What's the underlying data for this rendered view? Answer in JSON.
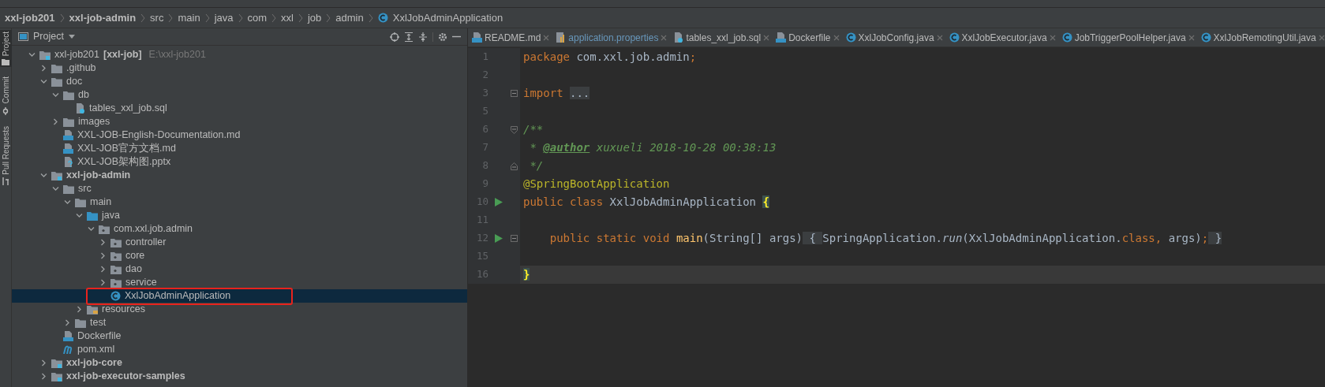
{
  "breadcrumbs": [
    {
      "label": "xxl-job201",
      "bold": true,
      "kind": "text"
    },
    {
      "label": "xxl-job-admin",
      "bold": true,
      "kind": "text"
    },
    {
      "label": "src",
      "bold": false,
      "kind": "text"
    },
    {
      "label": "main",
      "bold": false,
      "kind": "text"
    },
    {
      "label": "java",
      "bold": false,
      "kind": "text"
    },
    {
      "label": "com",
      "bold": false,
      "kind": "text"
    },
    {
      "label": "xxl",
      "bold": false,
      "kind": "text"
    },
    {
      "label": "job",
      "bold": false,
      "kind": "text"
    },
    {
      "label": "admin",
      "bold": false,
      "kind": "text"
    },
    {
      "label": "XxlJobAdminApplication",
      "bold": false,
      "kind": "class"
    }
  ],
  "tool_window_tabs": [
    {
      "label": "Project",
      "selected": true,
      "kind": "folder"
    },
    {
      "label": "Commit",
      "selected": false,
      "kind": "commit"
    },
    {
      "label": "Pull Requests",
      "selected": false,
      "kind": "pull"
    }
  ],
  "project_panel": {
    "title": "Project",
    "tree": [
      {
        "label": "xxl-job201",
        "suffix": "[xxl-job]",
        "hint": "E:\\xxl-job201",
        "kind": "module",
        "bold": false,
        "selected": false,
        "expanded": true,
        "children": [
          {
            "label": ".github",
            "kind": "folder",
            "bold": false,
            "selected": false,
            "expanded": false
          },
          {
            "label": "doc",
            "kind": "folder",
            "bold": false,
            "selected": false,
            "expanded": true,
            "children": [
              {
                "label": "db",
                "kind": "folder",
                "bold": false,
                "selected": false,
                "expanded": true,
                "children": [
                  {
                    "label": "tables_xxl_job.sql",
                    "kind": "sql",
                    "bold": false,
                    "selected": false
                  }
                ]
              },
              {
                "label": "images",
                "kind": "folder",
                "bold": false,
                "selected": false,
                "expanded": false
              },
              {
                "label": "XXL-JOB-English-Documentation.md",
                "kind": "md",
                "bold": false,
                "selected": false
              },
              {
                "label": "XXL-JOB官方文档.md",
                "kind": "md",
                "bold": false,
                "selected": false
              },
              {
                "label": "XXL-JOB架构图.pptx",
                "kind": "unknown",
                "bold": false,
                "selected": false
              }
            ]
          },
          {
            "label": "xxl-job-admin",
            "kind": "module",
            "bold": true,
            "selected": false,
            "expanded": true,
            "children": [
              {
                "label": "src",
                "kind": "folder",
                "bold": false,
                "selected": false,
                "expanded": true,
                "children": [
                  {
                    "label": "main",
                    "kind": "folder",
                    "bold": false,
                    "selected": false,
                    "expanded": true,
                    "children": [
                      {
                        "label": "java",
                        "kind": "source",
                        "bold": false,
                        "selected": false,
                        "expanded": true,
                        "children": [
                          {
                            "label": "com.xxl.job.admin",
                            "kind": "package",
                            "bold": false,
                            "selected": false,
                            "expanded": true,
                            "children": [
                              {
                                "label": "controller",
                                "kind": "package",
                                "bold": false,
                                "selected": false,
                                "expanded": false
                              },
                              {
                                "label": "core",
                                "kind": "package",
                                "bold": false,
                                "selected": false,
                                "expanded": false
                              },
                              {
                                "label": "dao",
                                "kind": "package",
                                "bold": false,
                                "selected": false,
                                "expanded": false
                              },
                              {
                                "label": "service",
                                "kind": "package",
                                "bold": false,
                                "selected": false,
                                "expanded": false
                              },
                              {
                                "label": "XxlJobAdminApplication",
                                "kind": "class",
                                "bold": false,
                                "selected": true,
                                "highlighted": true
                              }
                            ]
                          }
                        ]
                      },
                      {
                        "label": "resources",
                        "kind": "resources",
                        "bold": false,
                        "selected": false,
                        "expanded": false
                      }
                    ]
                  },
                  {
                    "label": "test",
                    "kind": "folder",
                    "bold": false,
                    "selected": false,
                    "expanded": false
                  }
                ]
              },
              {
                "label": "Dockerfile",
                "kind": "docker",
                "bold": false,
                "selected": false
              },
              {
                "label": "pom.xml",
                "kind": "maven",
                "bold": false,
                "selected": false
              }
            ]
          },
          {
            "label": "xxl-job-core",
            "kind": "module",
            "bold": true,
            "selected": false,
            "expanded": false
          },
          {
            "label": "xxl-job-executor-samples",
            "kind": "module",
            "bold": true,
            "selected": false,
            "expanded": false
          }
        ]
      }
    ]
  },
  "editor_tabs": [
    {
      "label": "README.md",
      "kind": "md",
      "modified": false
    },
    {
      "label": "application.properties",
      "kind": "properties",
      "modified": true
    },
    {
      "label": "tables_xxl_job.sql",
      "kind": "sql",
      "modified": false
    },
    {
      "label": "Dockerfile",
      "kind": "docker",
      "modified": false
    },
    {
      "label": "XxlJobConfig.java",
      "kind": "class",
      "modified": false
    },
    {
      "label": "XxlJobExecutor.java",
      "kind": "class",
      "modified": false
    },
    {
      "label": "JobTriggerPoolHelper.java",
      "kind": "class",
      "modified": false
    },
    {
      "label": "XxlJobRemotingUtil.java",
      "kind": "class",
      "modified": false
    }
  ],
  "code_lines": [
    {
      "number": "1",
      "run": false,
      "kind": "plain",
      "current": false,
      "tokens": [
        {
          "kind": "keyword",
          "text": "package "
        },
        {
          "kind": "plain",
          "text": "com.xxl.job.admin"
        },
        {
          "kind": "keyword",
          "text": ";"
        }
      ]
    },
    {
      "number": "2",
      "run": false,
      "kind": "plain",
      "current": false
    },
    {
      "number": "3",
      "run": false,
      "kind": "folded",
      "current": false,
      "tokens": [
        {
          "kind": "keyword",
          "text": "import "
        },
        {
          "kind": "folded",
          "text": "..."
        }
      ]
    },
    {
      "number": "5",
      "run": false,
      "kind": "plain",
      "current": false
    },
    {
      "number": "6",
      "run": false,
      "kind": "fold-start",
      "current": false,
      "tokens": [
        {
          "kind": "comment",
          "text": "/**"
        }
      ]
    },
    {
      "number": "7",
      "run": false,
      "kind": "plain",
      "current": false,
      "tokens": [
        {
          "kind": "comment",
          "text": " * "
        },
        {
          "kind": "doc-tag",
          "text": "@author"
        },
        {
          "kind": "comment",
          "text": " xuxueli 2018-10-28 00:38:13"
        }
      ]
    },
    {
      "number": "8",
      "run": false,
      "kind": "fold-end",
      "current": false,
      "tokens": [
        {
          "kind": "comment",
          "text": " */"
        }
      ]
    },
    {
      "number": "9",
      "run": false,
      "kind": "plain",
      "current": false,
      "tokens": [
        {
          "kind": "annotation",
          "text": "@SpringBootApplication"
        }
      ]
    },
    {
      "number": "10",
      "run": true,
      "kind": "plain",
      "current": false,
      "tokens": [
        {
          "kind": "keyword",
          "text": "public class "
        },
        {
          "kind": "plain",
          "text": "XxlJobAdminApplication "
        },
        {
          "kind": "brace",
          "text": "{"
        }
      ]
    },
    {
      "number": "11",
      "run": false,
      "kind": "plain",
      "current": false
    },
    {
      "number": "12",
      "run": true,
      "kind": "folded",
      "current": false,
      "tokens": [
        {
          "kind": "keyword",
          "text": "    public static void "
        },
        {
          "kind": "method",
          "text": "main"
        },
        {
          "kind": "plain",
          "text": "(String[] args)"
        },
        {
          "kind": "folded",
          "text": " { "
        },
        {
          "kind": "plain",
          "text": "SpringApplication."
        },
        {
          "kind": "static-call",
          "text": "run"
        },
        {
          "kind": "plain",
          "text": "(XxlJobAdminApplication."
        },
        {
          "kind": "keyword",
          "text": "class, "
        },
        {
          "kind": "plain",
          "text": "args)"
        },
        {
          "kind": "keyword",
          "text": ";"
        },
        {
          "kind": "folded",
          "text": " }"
        }
      ]
    },
    {
      "number": "15",
      "run": false,
      "kind": "plain",
      "current": false
    },
    {
      "number": "16",
      "run": false,
      "kind": "plain",
      "current": true,
      "tokens": [
        {
          "kind": "brace",
          "text": "}"
        }
      ]
    }
  ]
}
